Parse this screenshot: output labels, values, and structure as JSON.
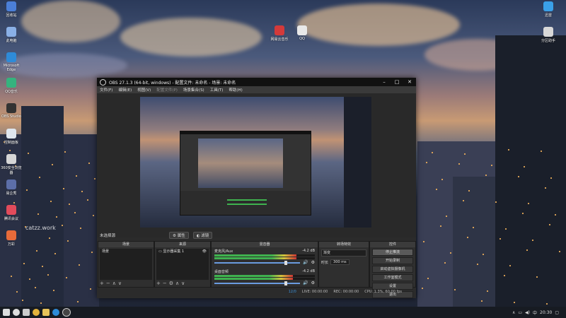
{
  "desktop": {
    "icons": [
      {
        "label": "回收站",
        "color": "#4b7fd8",
        "icon": "recycle-bin-icon"
      },
      {
        "label": "此电脑",
        "color": "#8ab0e6",
        "icon": "computer-icon"
      },
      {
        "label": "Microsoft Edge",
        "color": "#2e8bd8",
        "icon": "edge-icon"
      },
      {
        "label": "QQ音乐",
        "color": "#35b37e",
        "icon": "music-icon"
      },
      {
        "label": "OBS Studio",
        "color": "#333333",
        "icon": "obs-icon"
      },
      {
        "label": "控制面板",
        "color": "#dfe6ee",
        "icon": "doc-icon"
      },
      {
        "label": "360安全浏览器",
        "color": "#d6d6d6",
        "icon": "browser-icon"
      },
      {
        "label": "易企秀",
        "color": "#5c6ea8",
        "icon": "app-icon"
      },
      {
        "label": "腾讯会议",
        "color": "#e24b5b",
        "icon": "meeting-icon"
      },
      {
        "label": "万彩",
        "color": "#e86b3a",
        "icon": "app-icon-2"
      }
    ],
    "top_icons": [
      {
        "label": "网易云音乐",
        "color": "#d43a3a",
        "icon": "music-icon-2"
      },
      {
        "label": "QQ",
        "color": "#e8e8e8",
        "icon": "qq-icon"
      }
    ],
    "right_icons": [
      {
        "label": "迅雷",
        "color": "#3aa0e8",
        "icon": "thunder-icon"
      },
      {
        "label": "分区助手",
        "color": "#d8d8d8",
        "icon": "partition-icon"
      }
    ],
    "watermark": "catzz.work"
  },
  "obs": {
    "title": "OBS 27.1.3 (64-bit, windows) - 配置文件: 未命名 - 场景: 未命名",
    "menu": [
      "文件(F)",
      "编辑(E)",
      "视图(V)",
      "配置文件(P)",
      "场景集合(S)",
      "工具(T)",
      "帮助(H)"
    ],
    "scene_label": "未选择源",
    "scene_buttons": [
      "属性",
      "滤镜"
    ],
    "docks": {
      "scenes": {
        "title": "场景",
        "items": [
          "场景"
        ]
      },
      "sources": {
        "title": "来源",
        "items": [
          "显示器采集 1"
        ]
      },
      "mixer": {
        "title": "混音器",
        "channels": [
          {
            "name": "麦克风/Aux",
            "db": "-4.2 dB",
            "level": 0.82
          },
          {
            "name": "桌面音频",
            "db": "-4.2 dB",
            "level": 0.78
          }
        ]
      },
      "transitions": {
        "title": "转场特效",
        "type": "渐变",
        "duration_label": "时长",
        "duration": "300 ms"
      },
      "controls": {
        "title": "控件",
        "buttons": [
          "停止推流",
          "开始录制",
          "启动虚拟摄像机",
          "工作室模式",
          "设置",
          "退出"
        ]
      }
    },
    "status": {
      "live": "LIVE: 00:00:00",
      "rec": "REC: 00:00:00",
      "cpu": "CPU: 1.3%, 60.00 fps",
      "dropped": "12/0"
    }
  },
  "taskbar": {
    "time": "20:30",
    "lang": "中"
  }
}
